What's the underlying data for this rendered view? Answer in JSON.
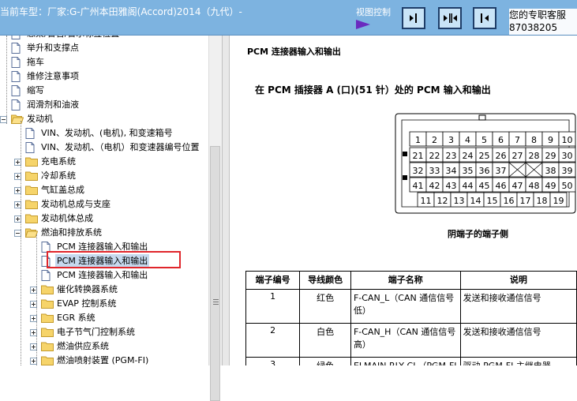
{
  "header": {
    "vehicle_text": "当前车型：厂家:G-广州本田雅阁(Accord)2014（九代）-",
    "view_control_label": "视图控制",
    "service_line1": "您的专职客服",
    "service_line2": "87038205"
  },
  "tree": {
    "items": [
      {
        "label": "悬架/警告/警示标签位置",
        "type": "doc"
      },
      {
        "label": "举升和支撑点",
        "type": "doc"
      },
      {
        "label": "拖车",
        "type": "doc"
      },
      {
        "label": "维修注意事项",
        "type": "doc"
      },
      {
        "label": "缩写",
        "type": "doc"
      },
      {
        "label": "润滑剂和油液",
        "type": "doc"
      },
      {
        "label": "发动机",
        "type": "folder-open"
      },
      {
        "label": "VIN、发动机、(电机), 和变速箱号",
        "type": "doc"
      },
      {
        "label": "VIN、发动机、（电机）和变速器编号位置",
        "type": "doc"
      },
      {
        "label": "充电系统",
        "type": "folder"
      },
      {
        "label": "冷却系统",
        "type": "folder"
      },
      {
        "label": "气缸盖总成",
        "type": "folder"
      },
      {
        "label": "发动机总成与支座",
        "type": "folder"
      },
      {
        "label": "发动机体总成",
        "type": "folder"
      },
      {
        "label": "燃油和排放系统",
        "type": "folder-open"
      },
      {
        "label": "PCM 连接器输入和输出",
        "type": "doc"
      },
      {
        "label": "PCM 连接器输入和输出",
        "type": "doc",
        "selected": true
      },
      {
        "label": "PCM 连接器输入和输出",
        "type": "doc"
      },
      {
        "label": "催化转换器系统",
        "type": "folder"
      },
      {
        "label": "EVAP 控制系统",
        "type": "folder"
      },
      {
        "label": "EGR 系统",
        "type": "folder"
      },
      {
        "label": "电子节气门控制系统",
        "type": "folder"
      },
      {
        "label": "燃油供应系统",
        "type": "folder"
      },
      {
        "label": "燃油喷射装置 (PGM-FI)",
        "type": "folder"
      }
    ]
  },
  "document": {
    "heading": "PCM 连接器输入和输出",
    "subheading": "在 PCM 插接器 A (口)(51 针）处的 PCM 输入和输出",
    "connector_caption": "阴端子的端子侧",
    "connector_rows": [
      [
        "1",
        "2",
        "3",
        "4",
        "5",
        "6",
        "7",
        "8",
        "9",
        "10"
      ],
      [
        "21",
        "22",
        "23",
        "24",
        "25",
        "26",
        "27",
        "28",
        "29",
        "30"
      ],
      [
        "32",
        "33",
        "34",
        "35",
        "36",
        "37",
        "",
        "",
        "38",
        "39"
      ],
      [
        "41",
        "42",
        "43",
        "44",
        "45",
        "46",
        "47",
        "48",
        "49",
        "50"
      ],
      [
        "11",
        "12",
        "13",
        "14",
        "15",
        "16",
        "17",
        "18",
        "19"
      ]
    ],
    "table": {
      "columns": [
        "端子编号",
        "导线颜色",
        "端子名称",
        "说明"
      ],
      "rows": [
        {
          "no": "1",
          "color": "红色",
          "name": "F-CAN_L（CAN 通信信号低）",
          "desc": "发送和接收通信信号"
        },
        {
          "no": "2",
          "color": "白色",
          "name": "F-CAN_H（CAN 通信信号高）",
          "desc": "发送和接收通信信号"
        },
        {
          "no": "3",
          "color": "绿色",
          "name": "ELMAIN RLY CL（PGM-FI",
          "desc": "驱动 PGM-FI 主继电器"
        }
      ]
    }
  }
}
